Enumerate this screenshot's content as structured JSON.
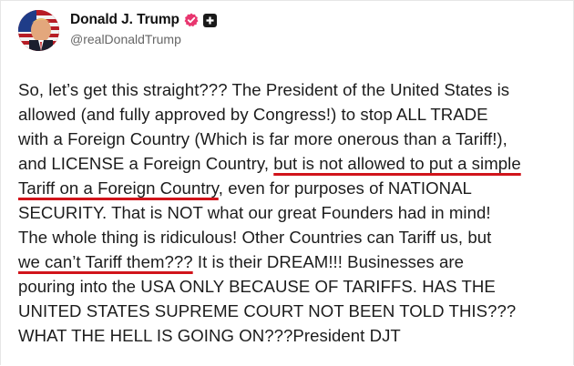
{
  "author": {
    "display_name": "Donald J. Trump",
    "handle": "@realDonaldTrump"
  },
  "icons": {
    "verified": "verified-badge-icon",
    "plus": "plus-square-icon"
  },
  "colors": {
    "verified_badge": "#e8366f",
    "underline": "#d1141b",
    "text": "#1c1c1c"
  },
  "post": {
    "l1": "So, let’s get this straight??? The President of the United States is",
    "l2": "allowed (and fully approved by Congress!) to stop ALL TRADE",
    "l3": "with a Foreign Country (Which is far more onerous than a Tariff!),",
    "l4a": "and LICENSE a Foreign Country, ",
    "l4b": "but is not allowed to put a simple",
    "l5a": "Tariff on a Foreign Country",
    "l5b": ", even for purposes of NATIONAL",
    "l6": "SECURITY. That is NOT what our great Founders had in mind!",
    "l7": "The whole thing is ridiculous! Other Countries can Tariff us, but",
    "l8a": "we can’t Tariff them???",
    "l8b": " It is their DREAM!!! Businesses are",
    "l9": "pouring into the USA ONLY BECAUSE OF TARIFFS. HAS THE",
    "l10": "UNITED STATES SUPREME COURT NOT BEEN TOLD THIS???",
    "l11": "WHAT THE HELL IS GOING ON???President DJT"
  }
}
